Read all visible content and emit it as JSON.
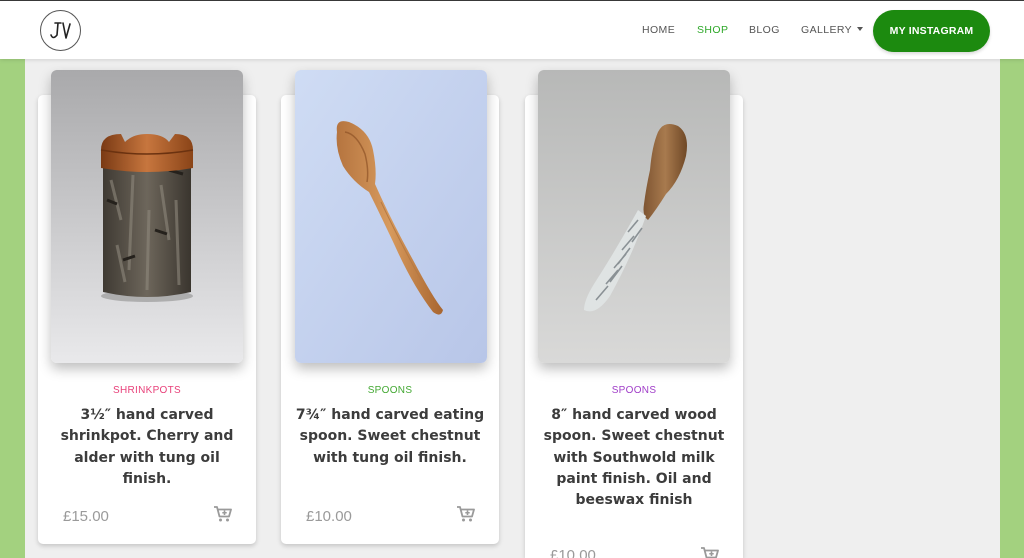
{
  "header": {
    "logo_text": "JV",
    "nav": [
      {
        "label": "HOME"
      },
      {
        "label": "SHOP"
      },
      {
        "label": "BLOG"
      },
      {
        "label": "GALLERY"
      }
    ],
    "instagram_button": "MY INSTAGRAM",
    "active_color": "#2ea829",
    "button_color": "#1c8a0f"
  },
  "products": [
    {
      "category": "SHRINKPOTS",
      "category_color": "#e8417a",
      "title": "3½″ hand carved shrinkpot. Cherry and alder with tung oil finish.",
      "price": "£15.00",
      "cart_icon": "cart-plus-icon"
    },
    {
      "category": "SPOONS",
      "category_color": "#43a832",
      "title": "7¾″ hand carved eating spoon. Sweet chestnut with tung oil finish.",
      "price": "£10.00",
      "cart_icon": "cart-plus-icon"
    },
    {
      "category": "SPOONS",
      "category_color": "#a03dc8",
      "title": "8″ hand carved wood spoon. Sweet chestnut with Southwold milk paint finish. Oil and beeswax finish",
      "price": "£10.00",
      "cart_icon": "cart-plus-icon"
    }
  ]
}
